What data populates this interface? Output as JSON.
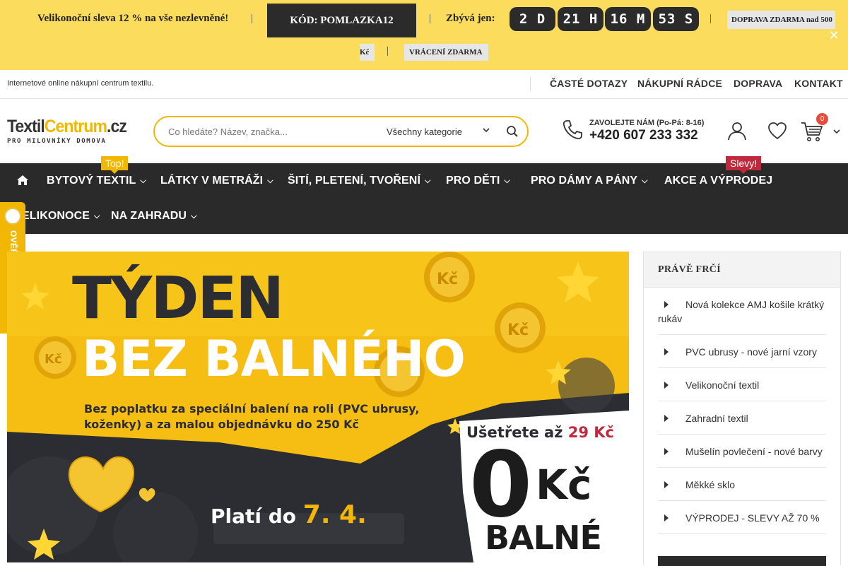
{
  "promo": {
    "sale_text": "Velikonoční sleva 12 % na vše nezlevněné!",
    "separator": "|",
    "code_label": "KÓD: POMLAZKA12",
    "remaining_label": "Zbývá jen:",
    "countdown": {
      "days": "2 D",
      "hours": "21 H",
      "minutes": "16 M",
      "seconds": "53 S"
    },
    "shipping_chip_line1": "DOPRAVA ZDARMA nad 500",
    "shipping_chip_line2": "Kč",
    "return_chip": "VRÁCENÍ ZDARMA",
    "close": "✕"
  },
  "infobar": {
    "tagline": "Internetové online nákupní centrum textilu.",
    "links": [
      "ČASTÉ DOTAZY",
      "NÁKUPNÍ RÁDCE",
      "DOPRAVA",
      "KONTAKT"
    ]
  },
  "header": {
    "logo_part1": "Textil",
    "logo_part2": "Centrum",
    "logo_part3": ".cz",
    "logo_tagline": "PRO MILOVNÍKY DOMOVA",
    "search_placeholder": "Co hledáte? Název, značka...",
    "search_category": "Všechny kategorie",
    "call_label": "ZAVOLEJTE NÁM (Po-Pá: 8-16)",
    "phone": "+420 607 233 332",
    "cart_count": "0",
    "icons": [
      "phone-icon",
      "user-icon",
      "heart-icon",
      "cart-icon",
      "search-icon"
    ]
  },
  "nav": {
    "items": [
      "BYTOVÝ TEXTIL",
      "LÁTKY V METRÁŽI",
      "ŠITÍ, PLETENÍ, TVOŘENÍ",
      "PRO DĚTI",
      "PRO DÁMY A PÁNY",
      "AKCE A VÝPRODEJ",
      "ELIKONOCE",
      "NA ZAHRADU"
    ],
    "badge_top": "Top!",
    "badge_sale": "Slevy!"
  },
  "verified": {
    "label": "OVĚŘENO ZÁKAZNÍKY"
  },
  "banner": {
    "title_line1": "TÝDEN",
    "title_line2": "BEZ BALNÉHO",
    "subtitle": "Bez poplatku za speciální balení na roli (PVC ubrusy, koženky) a za malou objednávku do 250 Kč",
    "save_prefix": "Ušetřete až",
    "save_amount": "29 Kč",
    "zero": "0",
    "currency": "Kč",
    "fee_word": "BALNÉ",
    "valid_prefix": "Platí do",
    "valid_date": "7. 4.",
    "colors": {
      "accent": "#f2b705",
      "dark": "#2b2d33",
      "red": "#c0283c"
    }
  },
  "sidebar": {
    "title": "PRÁVĚ FRČÍ",
    "items": [
      "Nová kolekce AMJ košile krátký rukáv",
      "PVC ubrusy - nové jarní vzory",
      "Velikonoční textil",
      "Zahradní textil",
      "Mušelín povlečení - nové barvy",
      "Měkké sklo",
      "VÝPRODEJ - SLEVY AŽ 70 %"
    ]
  }
}
